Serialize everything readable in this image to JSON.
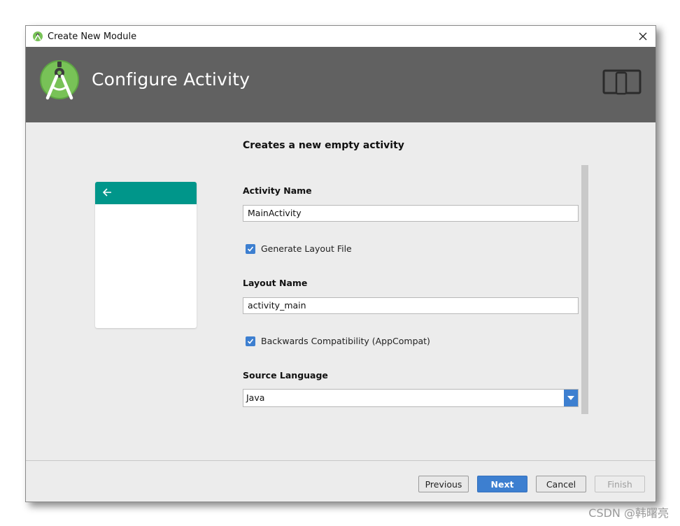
{
  "window": {
    "title": "Create New Module",
    "icons": {
      "app": "android-studio-icon",
      "close": "close-icon"
    }
  },
  "header": {
    "heading": "Configure Activity",
    "icons": {
      "logo": "android-studio-logo-icon",
      "device": "tablet-phone-icon"
    }
  },
  "preview": {
    "icons": {
      "back": "arrow-back-icon"
    },
    "appbar_color": "#00968a"
  },
  "form": {
    "description": "Creates a new empty activity",
    "activity_name": {
      "label": "Activity Name",
      "value": "MainActivity"
    },
    "generate_layout": {
      "label": "Generate Layout File",
      "checked": true
    },
    "layout_name": {
      "label": "Layout Name",
      "value": "activity_main"
    },
    "appcompat": {
      "label": "Backwards Compatibility (AppCompat)",
      "checked": true
    },
    "source_language": {
      "label": "Source Language",
      "value": "Java"
    }
  },
  "buttons": {
    "previous": "Previous",
    "next": "Next",
    "cancel": "Cancel",
    "finish": "Finish"
  },
  "colors": {
    "accent": "#3d7fd0",
    "header": "#616161",
    "teal": "#00968a"
  },
  "watermark": "CSDN @韩曙亮"
}
